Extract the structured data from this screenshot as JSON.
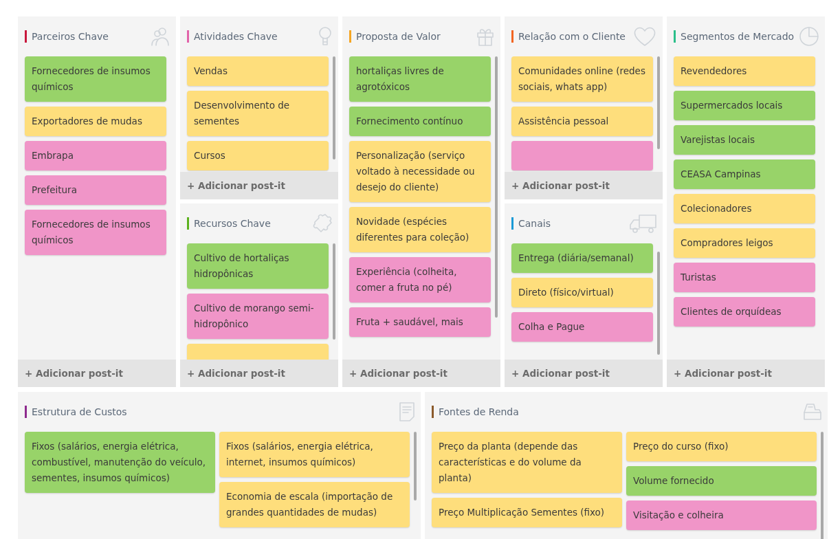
{
  "canvas": {
    "key_partners": {
      "title": "Parceiros Chave",
      "color": "#c8173c",
      "add_button": "+ Adicionar post-it",
      "notes": [
        {
          "text": "Fornecedores de insumos químicos",
          "color": "#98d369"
        },
        {
          "text": "Exportadores de mudas",
          "color": "#fede7c"
        },
        {
          "text": "Embrapa",
          "color": "#f095c8"
        },
        {
          "text": "Prefeitura",
          "color": "#f095c8"
        },
        {
          "text": "Fornecedores de insumos químicos",
          "color": "#f095c8"
        }
      ]
    },
    "key_activities": {
      "title": "Atividades Chave",
      "color": "#e264aa",
      "add_button": "+ Adicionar post-it",
      "notes": [
        {
          "text": "Vendas",
          "color": "#fede7c"
        },
        {
          "text": "Desenvolvimento de sementes",
          "color": "#fede7c"
        },
        {
          "text": "Cursos",
          "color": "#fede7c"
        }
      ]
    },
    "key_resources": {
      "title": "Recursos Chave",
      "color": "#5cb21e",
      "add_button": "+ Adicionar post-it",
      "notes": [
        {
          "text": "Cultivo de hortaliças hidropônicas",
          "color": "#98d369"
        },
        {
          "text": "Cultivo de morango semi-hidropônico",
          "color": "#f095c8"
        },
        {
          "color": "#fede7c"
        }
      ]
    },
    "value_propositions": {
      "title": "Proposta de Valor",
      "color": "#f5a623",
      "add_button": "+ Adicionar post-it",
      "notes": [
        {
          "text": "hortaliças livres de agrotóxicos",
          "color": "#98d369"
        },
        {
          "text": "Fornecimento contínuo",
          "color": "#98d369"
        },
        {
          "text": "Personalização (serviço voltado à necessidade ou desejo do cliente)",
          "color": "#fede7c"
        },
        {
          "text": "Novidade (espécies diferentes para coleção)",
          "color": "#fede7c"
        },
        {
          "text": "Experiência (colheita, comer a fruta no pé)",
          "color": "#f095c8"
        },
        {
          "text": "Fruta + saudável, mais",
          "color": "#f095c8"
        }
      ]
    },
    "customer_relationships": {
      "title": "Relação com o Cliente",
      "color": "#f26522",
      "add_button": "+ Adicionar post-it",
      "notes": [
        {
          "text": "Comunidades online (redes sociais, whats app)",
          "color": "#fede7c"
        },
        {
          "text": "Assistência pessoal",
          "color": "#fede7c"
        },
        {
          "color": "#f095c8"
        }
      ]
    },
    "channels": {
      "title": "Canais",
      "color": "#1a9ad6",
      "add_button": "+ Adicionar post-it",
      "notes": [
        {
          "text": "Entrega (diária/semanal)",
          "color": "#98d369"
        },
        {
          "text": "Direto (físico/virtual)",
          "color": "#fede7c"
        },
        {
          "text": "Colha e Pague",
          "color": "#f095c8"
        }
      ]
    },
    "customer_segments": {
      "title": "Segmentos de Mercado",
      "color": "#2bbf8a",
      "add_button": "+ Adicionar post-it",
      "notes": [
        {
          "text": "Revendedores",
          "color": "#fede7c"
        },
        {
          "text": "Supermercados locais",
          "color": "#98d369"
        },
        {
          "text": "Varejistas locais",
          "color": "#98d369"
        },
        {
          "text": "CEASA Campinas",
          "color": "#98d369"
        },
        {
          "text": "Colecionadores",
          "color": "#fede7c"
        },
        {
          "text": "Compradores leigos",
          "color": "#fede7c"
        },
        {
          "text": "Turistas",
          "color": "#f095c8"
        },
        {
          "text": "Clientes de orquídeas",
          "color": "#f095c8"
        }
      ]
    },
    "cost_structure": {
      "title": "Estrutura de Custos",
      "color": "#8e2a8e",
      "columns": [
        [
          {
            "text": "Fixos (salários, energia elétrica, combustível, manutenção do veículo, sementes, insumos químicos)",
            "color": "#98d369"
          }
        ],
        [
          {
            "text": "Fixos (salários, energia elétrica, internet, insumos químicos)",
            "color": "#fede7c"
          },
          {
            "text": "Economia de escala (importação de grandes quantidades de mudas)",
            "color": "#fede7c"
          }
        ]
      ]
    },
    "revenue_streams": {
      "title": "Fontes de Renda",
      "color": "#8b5a2b",
      "columns": [
        [
          {
            "text": "Preço da planta (depende das características e do volume da planta)",
            "color": "#fede7c"
          },
          {
            "text": "Preço Multiplicação Sementes (fixo)",
            "color": "#fede7c"
          }
        ],
        [
          {
            "text": "Preço do curso (fixo)",
            "color": "#fede7c"
          },
          {
            "text": "Volume fornecido",
            "color": "#98d369"
          },
          {
            "text": "Visitação e colheira",
            "color": "#f095c8"
          }
        ]
      ]
    }
  }
}
